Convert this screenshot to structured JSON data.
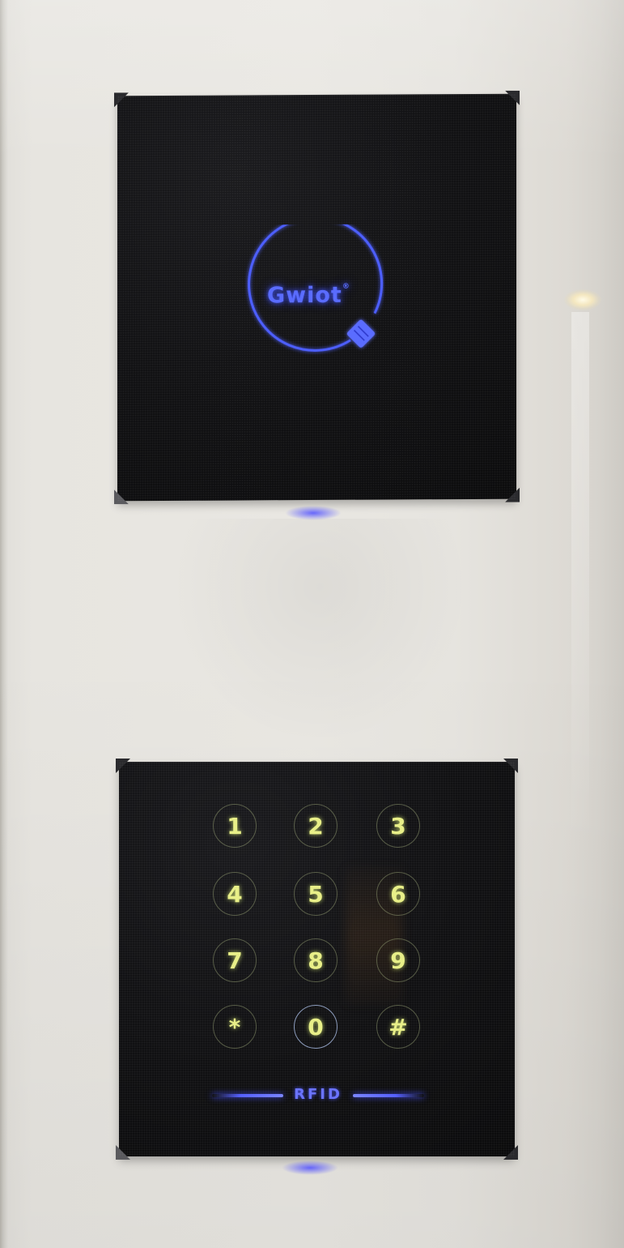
{
  "scene": {
    "background_color": "#e7e5e0",
    "panel_color": "#111113"
  },
  "card_reader": {
    "logo_text": "Gwiot",
    "logo_mark": "®",
    "glow_color": "#4a5cff",
    "icon": "card-tap-icon"
  },
  "keypad_reader": {
    "keys": [
      "1",
      "2",
      "3",
      "4",
      "5",
      "6",
      "7",
      "8",
      "9",
      "*",
      "0",
      "#"
    ],
    "key_color": "#e8ef88",
    "rfid_label": "RFID",
    "rfid_color": "#5560ff"
  }
}
